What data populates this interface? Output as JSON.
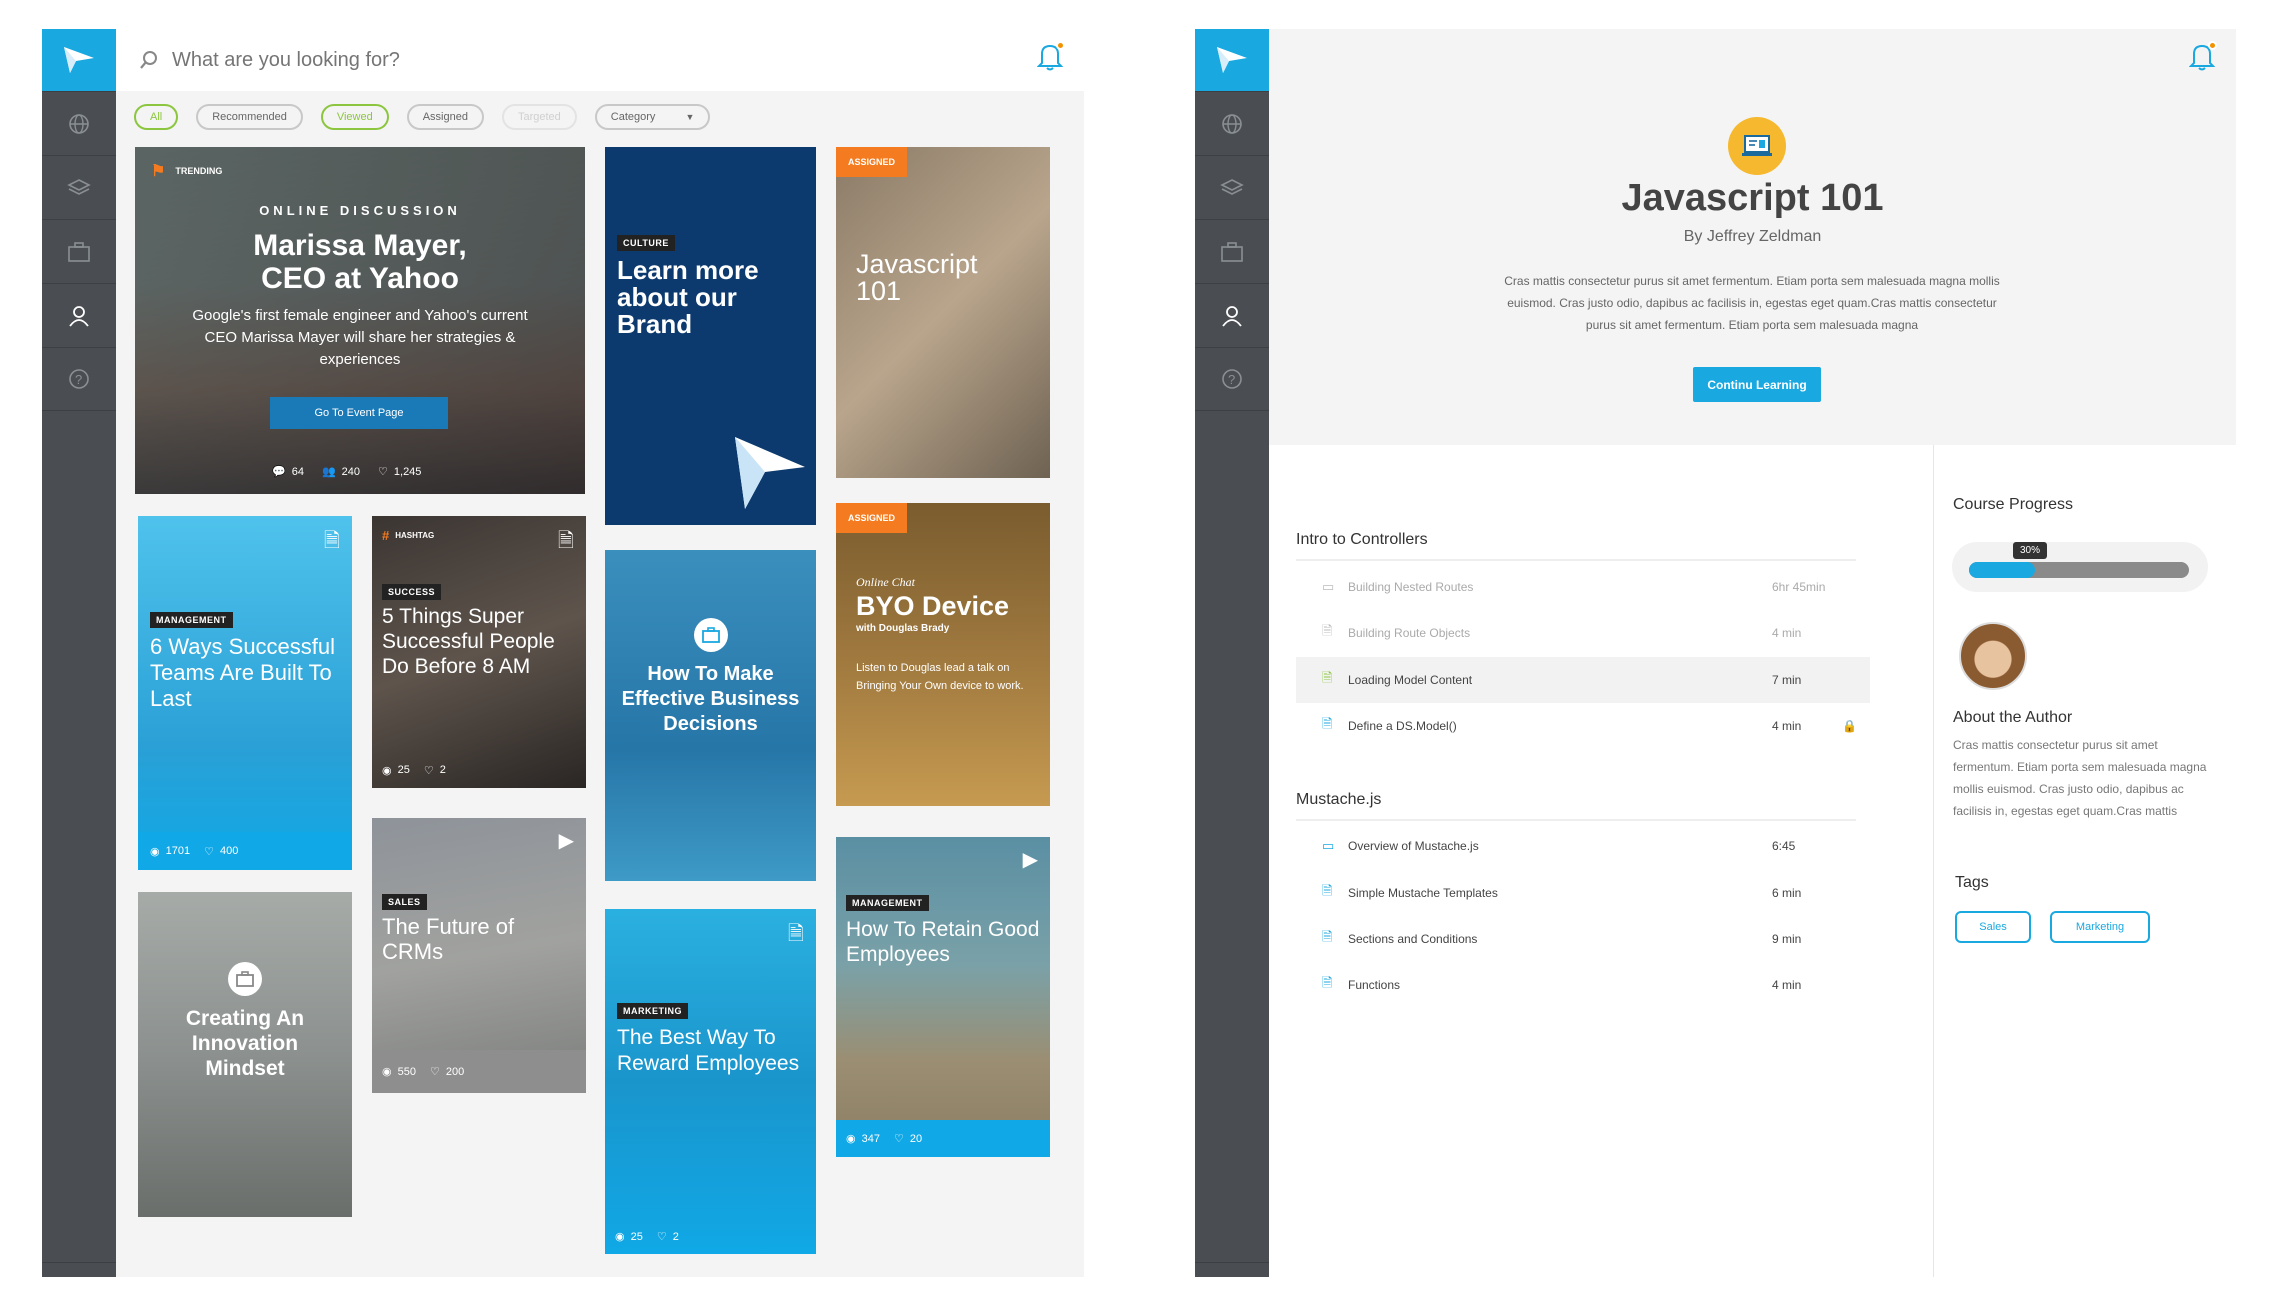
{
  "search": {
    "placeholder": "What are you looking for?"
  },
  "filters": [
    {
      "label": "All",
      "state": "active"
    },
    {
      "label": "Recommended",
      "state": "normal"
    },
    {
      "label": "Viewed",
      "state": "active"
    },
    {
      "label": "Assigned",
      "state": "normal"
    },
    {
      "label": "Targeted",
      "state": "disabled"
    },
    {
      "label": "Category",
      "state": "normal"
    }
  ],
  "cards": {
    "marissa": {
      "badge": "TRENDING",
      "kicker": "ONLINE DISCUSSION",
      "title_line1": "Marissa Mayer,",
      "title_line2": "CEO at Yahoo",
      "desc": "Google's first female engineer and Yahoo's current CEO Marissa Mayer will share her strategies & experiences",
      "button": "Go To Event Page",
      "comments": "64",
      "attendees": "240",
      "likes": "1,245"
    },
    "brand": {
      "tag": "CULTURE",
      "title": "Learn more about our Brand"
    },
    "js101": {
      "tag": "ASSIGNED",
      "title": "Javascript 101"
    },
    "sixways": {
      "tag": "MANAGEMENT",
      "title": "6 Ways Successful Teams Are Built To Last",
      "views": "1701",
      "likes": "400"
    },
    "fivethings": {
      "badge": "HASHTAG",
      "tag": "SUCCESS",
      "title": "5 Things Super Successful People Do Before 8 AM",
      "views": "25",
      "likes": "2"
    },
    "effective": {
      "title": "How To Make Effective Business Decisions"
    },
    "byo": {
      "tag": "ASSIGNED",
      "kicker": "Online Chat",
      "title": "BYO Device",
      "sub": "with Douglas Brady",
      "desc": "Listen to Douglas lead a talk on Bringing Your Own device to work."
    },
    "innovation": {
      "title": "Creating An Innovation Mindset"
    },
    "crms": {
      "tag": "SALES",
      "title": "The Future of CRMs",
      "views": "550",
      "likes": "200"
    },
    "retain": {
      "tag": "MANAGEMENT",
      "title": "How To Retain Good Employees",
      "views": "347",
      "likes": "20"
    },
    "reward": {
      "tag": "MARKETING",
      "title": "The Best Way To Reward Employees",
      "views": "25",
      "likes": "2"
    }
  },
  "course": {
    "title": "Javascript 101",
    "author_line": "By Jeffrey Zeldman",
    "desc": "Cras mattis consectetur purus sit amet fermentum. Etiam porta sem malesuada magna mollis euismod. Cras justo odio, dapibus ac facilisis in, egestas eget quam.Cras mattis consectetur purus sit amet fermentum. Etiam porta sem malesuada magna",
    "cta": "Continu Learning"
  },
  "sections": [
    {
      "title": "Intro to Controllers",
      "lessons": [
        {
          "title": "Building Nested Routes",
          "duration": "6hr 45min",
          "icon": "video-icon",
          "state": "dim"
        },
        {
          "title": "Building Route Objects",
          "duration": "4 min",
          "icon": "doc-icon",
          "state": "dim"
        },
        {
          "title": "Loading Model Content",
          "duration": "7 min",
          "icon": "doc-icon",
          "state": "current"
        },
        {
          "title": "Define a DS.Model()",
          "duration": "4 min",
          "icon": "doc-icon",
          "state": "locked"
        }
      ]
    },
    {
      "title": "Mustache.js",
      "lessons": [
        {
          "title": "Overview of Mustache.js",
          "duration": "6:45",
          "icon": "video-icon",
          "state": "normal"
        },
        {
          "title": "Simple Mustache Templates",
          "duration": "6 min",
          "icon": "doc-icon",
          "state": "normal"
        },
        {
          "title": "Sections and Conditions",
          "duration": "9 min",
          "icon": "doc-icon",
          "state": "normal"
        },
        {
          "title": "Functions",
          "duration": "4 min",
          "icon": "doc-icon",
          "state": "normal"
        }
      ]
    }
  ],
  "progress": {
    "heading": "Course Progress",
    "percent_label": "30%",
    "value": 0.3
  },
  "author": {
    "heading": "About the Author",
    "bio": "Cras mattis consectetur purus sit amet fermentum. Etiam porta sem malesuada magna mollis euismod. Cras justo odio, dapibus ac facilisis in, egestas eget quam.Cras mattis"
  },
  "tags": {
    "heading": "Tags",
    "items": [
      "Sales",
      "Marketing"
    ]
  },
  "colors": {
    "accent": "#1aa8e0",
    "rail": "#4a4e52",
    "orange": "#f47b20",
    "green": "#8cc63f"
  }
}
